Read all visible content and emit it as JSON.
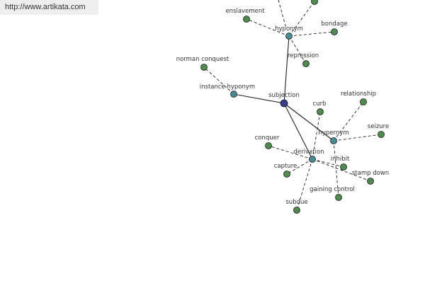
{
  "header": {
    "url_text": "http://www.artikata.com"
  },
  "colors": {
    "hub": "#3a3d8c",
    "relation": "#4a8a94",
    "term": "#4f8a4f",
    "edge": "#222222",
    "background": "#ffffff"
  },
  "graph": {
    "nodes": [
      {
        "id": "subjection",
        "label": "subjection",
        "kind": "hub"
      },
      {
        "id": "hyponym",
        "label": "hyponym",
        "kind": "relation"
      },
      {
        "id": "instance-hyponym",
        "label": "instance hyponym",
        "kind": "relation"
      },
      {
        "id": "hypernym",
        "label": "hypernym",
        "kind": "relation"
      },
      {
        "id": "derivation",
        "label": "derivation",
        "kind": "relation"
      },
      {
        "id": "enslavement",
        "label": "enslavement",
        "kind": "term"
      },
      {
        "id": "bondage",
        "label": "bondage",
        "kind": "term"
      },
      {
        "id": "repression",
        "label": "repression",
        "kind": "term"
      },
      {
        "id": "norman-conquest",
        "label": "norman conquest",
        "kind": "term"
      },
      {
        "id": "curb",
        "label": "curb",
        "kind": "term"
      },
      {
        "id": "relationship",
        "label": "relationship",
        "kind": "term"
      },
      {
        "id": "seizure",
        "label": "seizure",
        "kind": "term"
      },
      {
        "id": "conquer",
        "label": "conquer",
        "kind": "term"
      },
      {
        "id": "inhibit",
        "label": "inhibit",
        "kind": "term"
      },
      {
        "id": "capture",
        "label": "capture",
        "kind": "term"
      },
      {
        "id": "stamp-down",
        "label": "stamp down",
        "kind": "term"
      },
      {
        "id": "gaining-control",
        "label": "gaining control",
        "kind": "term"
      },
      {
        "id": "subdue",
        "label": "subdue",
        "kind": "term"
      },
      {
        "id": "offscreen-top-1",
        "label": "",
        "kind": "term"
      }
    ],
    "edges": [
      {
        "from": "subjection",
        "to": "hyponym",
        "style": "solid"
      },
      {
        "from": "subjection",
        "to": "instance-hyponym",
        "style": "solid"
      },
      {
        "from": "subjection",
        "to": "hypernym",
        "style": "solid"
      },
      {
        "from": "subjection",
        "to": "derivation",
        "style": "solid"
      },
      {
        "from": "hyponym",
        "to": "enslavement",
        "style": "dashed"
      },
      {
        "from": "hyponym",
        "to": "bondage",
        "style": "dashed"
      },
      {
        "from": "hyponym",
        "to": "repression",
        "style": "dashed"
      },
      {
        "from": "hyponym",
        "to": "offscreen-top-1",
        "style": "dashed"
      },
      {
        "from": "instance-hyponym",
        "to": "norman-conquest",
        "style": "dashed"
      },
      {
        "from": "hypernym",
        "to": "relationship",
        "style": "dashed"
      },
      {
        "from": "hypernym",
        "to": "seizure",
        "style": "dashed"
      },
      {
        "from": "hypernym",
        "to": "gaining-control",
        "style": "dashed"
      },
      {
        "from": "derivation",
        "to": "curb",
        "style": "dashed"
      },
      {
        "from": "derivation",
        "to": "conquer",
        "style": "dashed"
      },
      {
        "from": "derivation",
        "to": "inhibit",
        "style": "dashed"
      },
      {
        "from": "derivation",
        "to": "capture",
        "style": "dashed"
      },
      {
        "from": "derivation",
        "to": "stamp-down",
        "style": "dashed"
      },
      {
        "from": "derivation",
        "to": "subdue",
        "style": "dashed"
      }
    ]
  }
}
